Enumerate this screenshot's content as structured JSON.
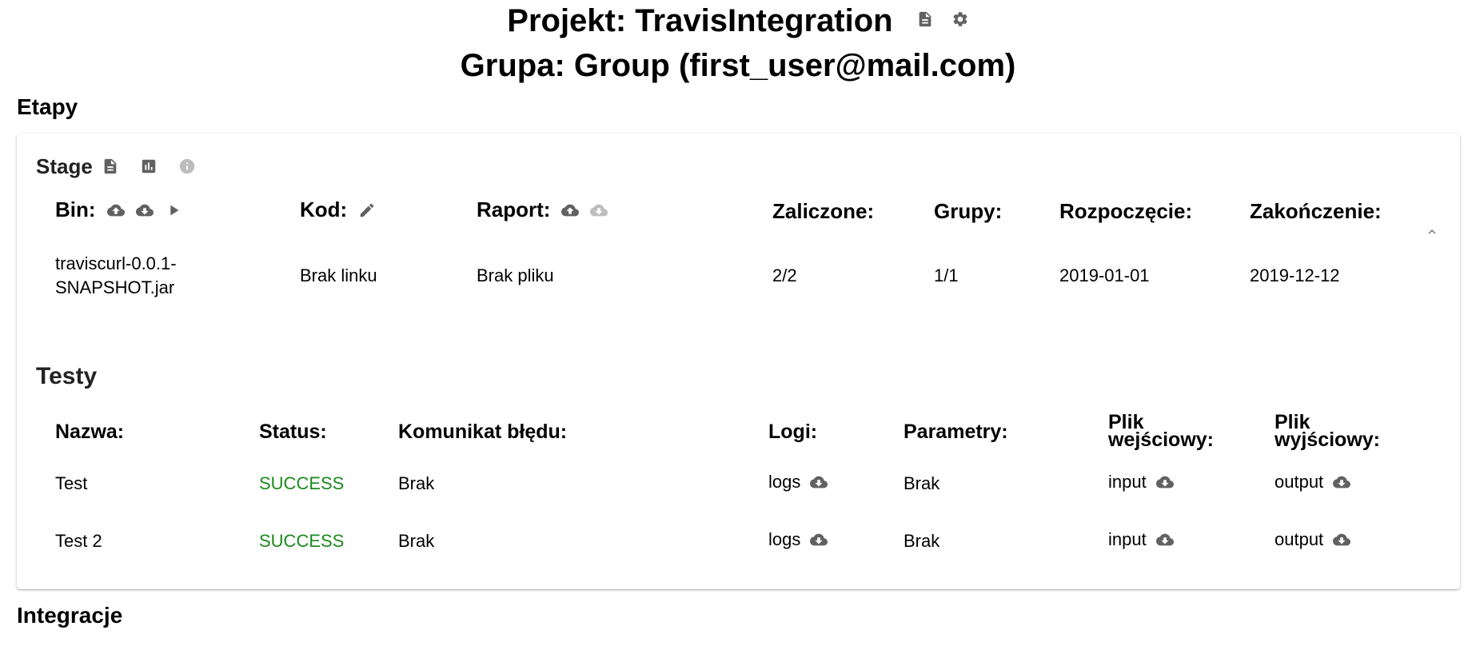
{
  "header": {
    "project_title": "Projekt: TravisIntegration",
    "group_title": "Grupa: Group (first_user@mail.com)",
    "icons": [
      "file-document-icon",
      "gear-icon"
    ]
  },
  "sections": {
    "etapy": "Etapy",
    "integracje": "Integracje"
  },
  "stage": {
    "title": "Stage",
    "icons": [
      "file-document-icon",
      "chart-icon",
      "info-icon"
    ],
    "columns": {
      "bin": "Bin:",
      "kod": "Kod:",
      "raport": "Raport:",
      "zaliczone": "Zaliczone:",
      "grupy": "Grupy:",
      "rozpoczecie": "Rozpoczęcie:",
      "zakonczenie": "Zakończenie:"
    },
    "row": {
      "bin_line1": "traviscurl-0.0.1-",
      "bin_line2": "SNAPSHOT.jar",
      "kod": "Brak linku",
      "raport": "Brak pliku",
      "zaliczone": "2/2",
      "grupy": "1/1",
      "rozpoczecie": "2019-01-01",
      "zakonczenie": "2019-12-12"
    }
  },
  "tests": {
    "title": "Testy",
    "columns": {
      "nazwa": "Nazwa:",
      "status": "Status:",
      "komunikat": "Komunikat błędu:",
      "logi": "Logi:",
      "parametry": "Parametry:",
      "plik_wejsciowy_1": "Plik",
      "plik_wejsciowy_2": "wejściowy:",
      "plik_wyjsciowy_1": "Plik",
      "plik_wyjsciowy_2": "wyjściowy:"
    },
    "rows": [
      {
        "nazwa": "Test",
        "status": "SUCCESS",
        "komunikat": "Brak",
        "logi": "logs",
        "parametry": "Brak",
        "input": "input",
        "output": "output"
      },
      {
        "nazwa": "Test 2",
        "status": "SUCCESS",
        "komunikat": "Brak",
        "logi": "logs",
        "parametry": "Brak",
        "input": "input",
        "output": "output"
      }
    ]
  },
  "colors": {
    "success": "#1b8a1b",
    "icon": "#616161",
    "icon_disabled": "#bdbdbd"
  }
}
